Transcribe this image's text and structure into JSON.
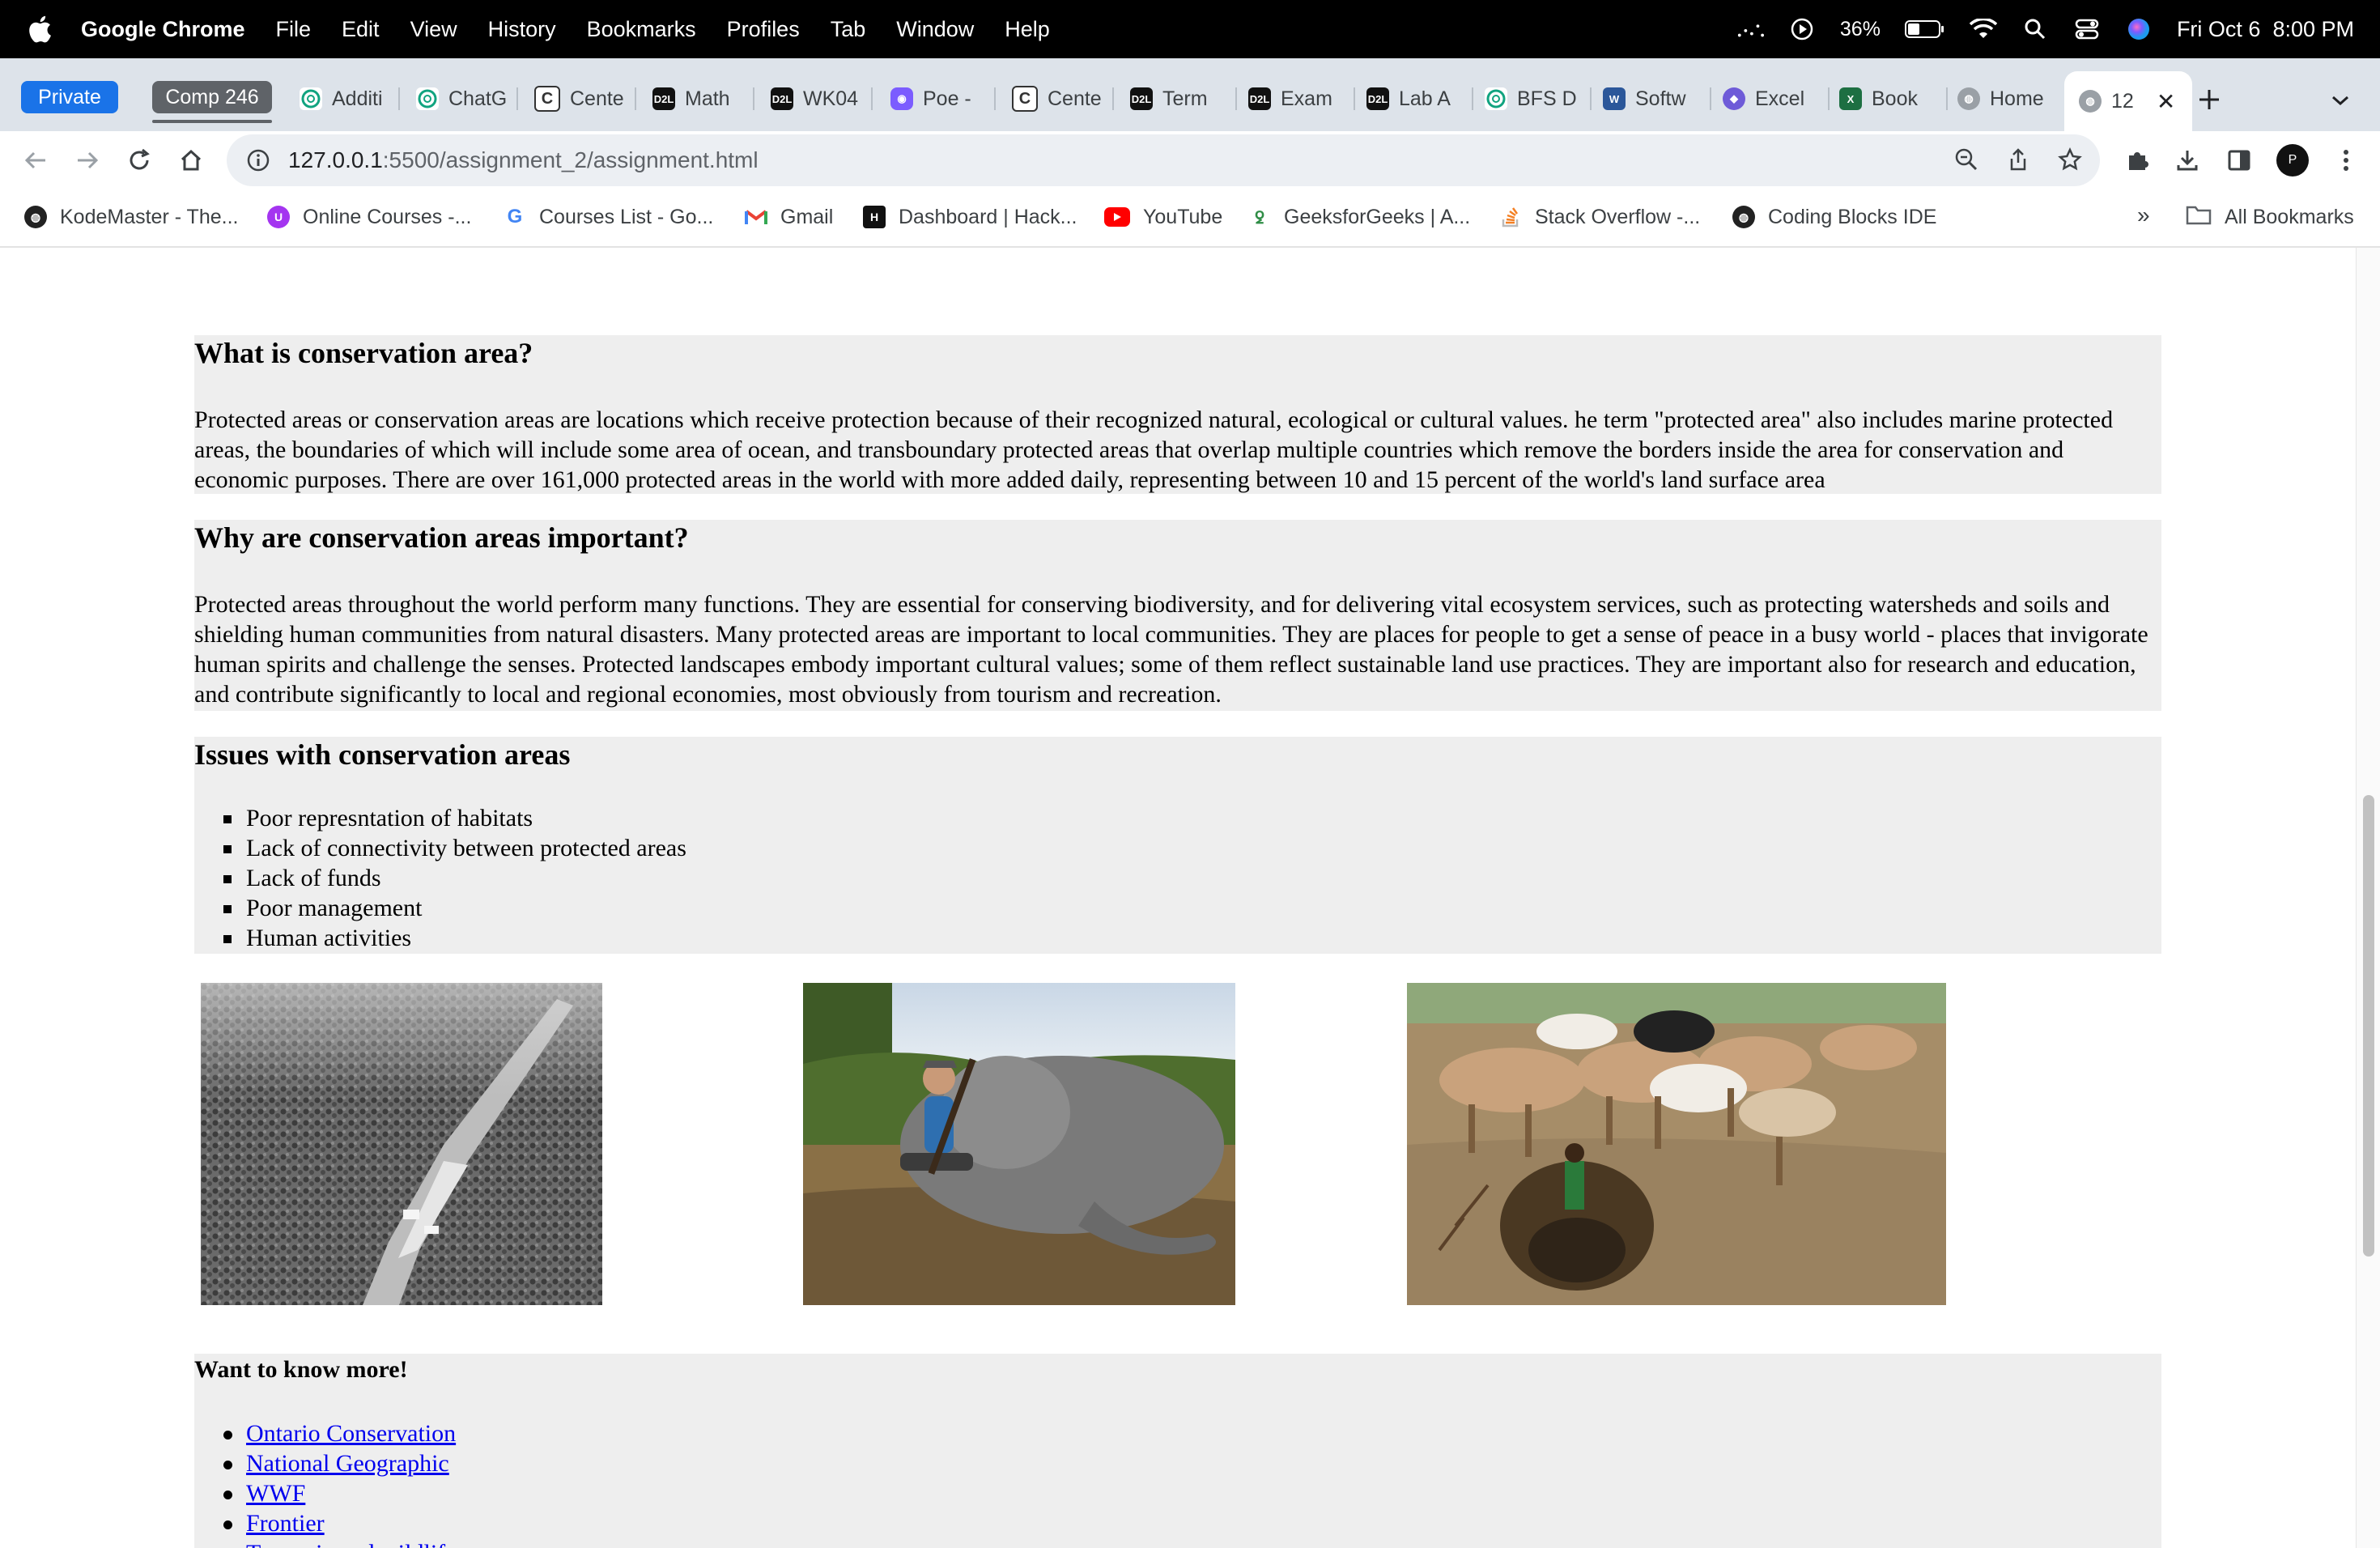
{
  "menubar": {
    "app": "Google Chrome",
    "items": [
      "File",
      "Edit",
      "View",
      "History",
      "Bookmarks",
      "Profiles",
      "Tab",
      "Window",
      "Help"
    ],
    "battery": "36%",
    "clock": "Fri Oct 6  8:00 PM"
  },
  "tabs": {
    "private_label": "Private",
    "group_label": "Comp 246",
    "items": [
      {
        "title": "Additi",
        "icon": "chatgpt-icon"
      },
      {
        "title": "ChatG",
        "icon": "chatgpt-icon"
      },
      {
        "title": "Cente",
        "icon": "c-icon"
      },
      {
        "title": "Math",
        "icon": "d2l-icon"
      },
      {
        "title": "WK04",
        "icon": "d2l-icon"
      },
      {
        "title": "Poe -",
        "icon": "poe-icon"
      },
      {
        "title": "Cente",
        "icon": "c-icon"
      },
      {
        "title": "Term",
        "icon": "d2l-icon"
      },
      {
        "title": "Exam",
        "icon": "d2l-icon"
      },
      {
        "title": "Lab A",
        "icon": "d2l-icon"
      },
      {
        "title": "BFS D",
        "icon": "chatgpt-icon"
      },
      {
        "title": "Softw",
        "icon": "word-icon"
      },
      {
        "title": "Excel",
        "icon": "copilot-icon"
      },
      {
        "title": "Book",
        "icon": "excel-icon"
      },
      {
        "title": "Home",
        "icon": "globe-icon"
      }
    ],
    "active_title": "12"
  },
  "toolbar": {
    "url_host": "127.0.0.1",
    "url_rest": ":5500/assignment_2/assignment.html",
    "avatar_letter": "P"
  },
  "bookmarks": {
    "items": [
      "KodeMaster - The...",
      "Online Courses -...",
      "Courses List - Go...",
      "Gmail",
      "Dashboard | Hack...",
      "YouTube",
      "GeeksforGeeks | A...",
      "Stack Overflow -...",
      "Coding Blocks IDE"
    ],
    "more": "»",
    "all_label": "All Bookmarks"
  },
  "page": {
    "s1": {
      "heading": "What is conservation area?",
      "text": "Protected areas or conservation areas are locations which receive protection because of their recognized natural, ecological or cultural values. he term \"protected area\" also includes marine protected areas, the boundaries of which will include some area of ocean, and transboundary protected areas that overlap multiple countries which remove the borders inside the area for conservation and economic purposes. There are over 161,000 protected areas in the world with more added daily, representing between 10 and 15 percent of the world's land surface area"
    },
    "s2": {
      "heading": "Why are conservation areas important?",
      "text": "Protected areas throughout the world perform many functions. They are essential for conserving biodiversity, and for delivering vital ecosystem services, such as protecting watersheds and soils and shielding human communities from natural disasters. Many protected areas are important to local communities. They are places for people to get a sense of peace in a busy world - places that invigorate human spirits and challenge the senses. Protected landscapes embody important cultural values; some of them reflect sustainable land use practices. They are important also for research and education, and contribute significantly to local and regional economies, most obviously from tourism and recreation."
    },
    "s3": {
      "heading": "Issues with conservation areas",
      "items": [
        "Poor represntation of habitats",
        "Lack of connectivity between protected areas",
        "Lack of funds",
        "Poor management",
        "Human activities"
      ]
    },
    "s4": {
      "heading": "Want to know more!",
      "links": [
        "Ontario Conservation",
        "National Geographic",
        "WWF",
        "Frontier",
        "Tanzania and wildlife"
      ]
    }
  },
  "colors": {
    "section_bg": "#eeeeee",
    "link": "#0000ee",
    "private_pill": "#1a73e8"
  }
}
